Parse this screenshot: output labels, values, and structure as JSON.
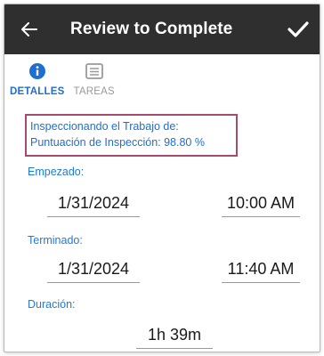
{
  "header": {
    "title": "Review to Complete"
  },
  "tabs": [
    {
      "label": "DETALLES",
      "icon": "info-icon",
      "active": true
    },
    {
      "label": "TAREAS",
      "icon": "list-icon",
      "active": false
    }
  ],
  "info": {
    "line1": "Inspeccionando el Trabajo de:",
    "line2": "Puntuación de Inspección: 98.80 %"
  },
  "started": {
    "label": "Empezado:",
    "date": "1/31/2024",
    "time": "10:00 AM"
  },
  "finished": {
    "label": "Terminado:",
    "date": "1/31/2024",
    "time": "11:40 AM"
  },
  "duration": {
    "label": "Duración:",
    "value": "1h 39m"
  },
  "colors": {
    "accent": "#1f6fd0",
    "appbar": "#2f2f2f",
    "highlight_border": "#a64a6e"
  }
}
